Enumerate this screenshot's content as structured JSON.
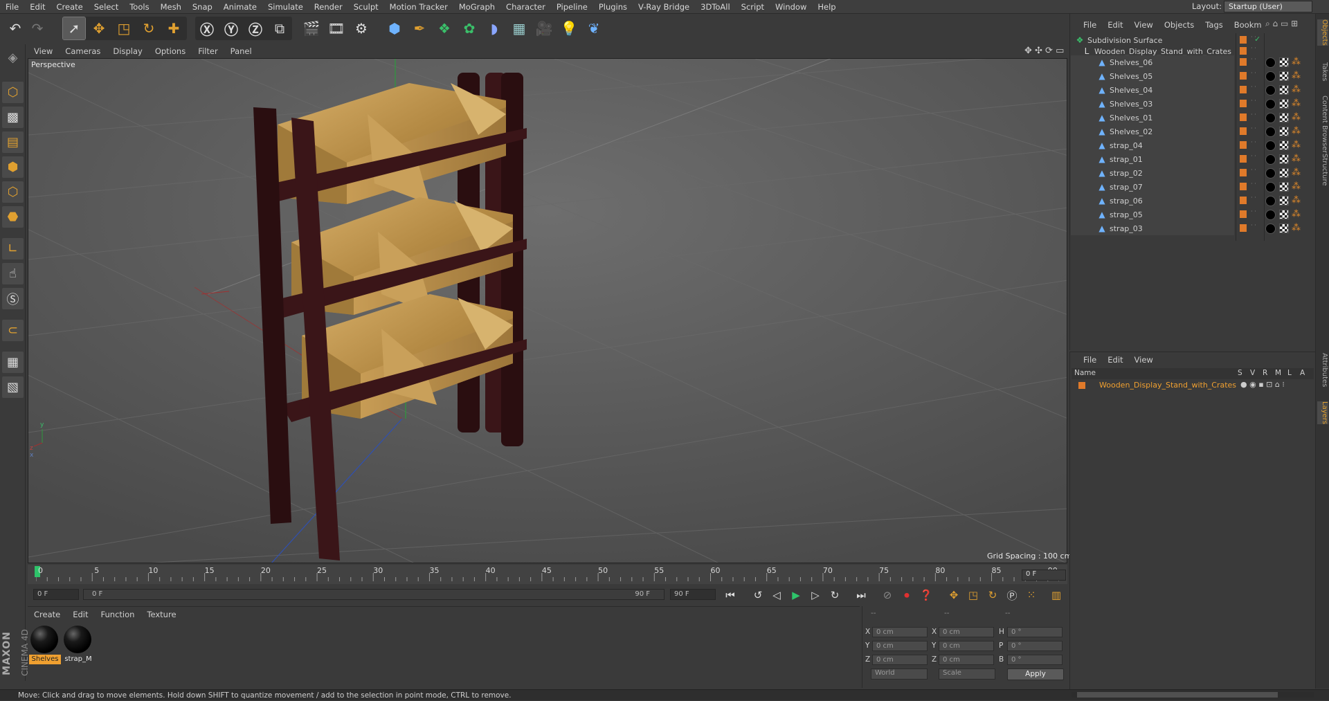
{
  "menubar": {
    "items": [
      "File",
      "Edit",
      "Create",
      "Select",
      "Tools",
      "Mesh",
      "Snap",
      "Animate",
      "Simulate",
      "Render",
      "Sculpt",
      "Motion Tracker",
      "MoGraph",
      "Character",
      "Pipeline",
      "Plugins",
      "V-Ray Bridge",
      "3DToAll",
      "Script",
      "Window",
      "Help"
    ],
    "layout_label": "Layout:",
    "layout_value": "Startup (User)"
  },
  "viewport": {
    "menu": [
      "View",
      "Cameras",
      "Display",
      "Options",
      "Filter",
      "Panel"
    ],
    "label": "Perspective",
    "grid_spacing": "Grid Spacing : 100 cm"
  },
  "timeline": {
    "ticks": [
      "0",
      "5",
      "10",
      "15",
      "20",
      "25",
      "30",
      "35",
      "40",
      "45",
      "50",
      "55",
      "60",
      "65",
      "70",
      "75",
      "80",
      "85",
      "90"
    ],
    "current_frame": "0 F",
    "start_field": "0 F",
    "range_start": "0 F",
    "range_end": "90 F",
    "end_field": "90 F"
  },
  "materials": {
    "menu": [
      "Create",
      "Edit",
      "Function",
      "Texture"
    ],
    "items": [
      {
        "label": "Shelves",
        "selected": true
      },
      {
        "label": "strap_M",
        "selected": false
      }
    ]
  },
  "coords": {
    "header_a": "--",
    "header_b": "--",
    "header_c": "--",
    "rows": [
      {
        "l1": "X",
        "v1": "0 cm",
        "l2": "X",
        "v2": "0 cm",
        "l3": "H",
        "v3": "0 °"
      },
      {
        "l1": "Y",
        "v1": "0 cm",
        "l2": "Y",
        "v2": "0 cm",
        "l3": "P",
        "v3": "0 °"
      },
      {
        "l1": "Z",
        "v1": "0 cm",
        "l2": "Z",
        "v2": "0 cm",
        "l3": "B",
        "v3": "0 °"
      }
    ],
    "world": "World",
    "scale": "Scale",
    "apply": "Apply"
  },
  "status": "Move: Click and drag to move elements. Hold down SHIFT to quantize movement / add to the selection in point mode, CTRL to remove.",
  "brand": {
    "maxon": "MAXON",
    "c4d": "CINEMA 4D"
  },
  "objects": {
    "menu": [
      "File",
      "Edit",
      "View",
      "Objects",
      "Tags",
      "Bookm"
    ],
    "root": "Subdivision Surface",
    "group": "Wooden_Display_Stand_with_Crates",
    "children": [
      "Shelves_06",
      "Shelves_05",
      "Shelves_04",
      "Shelves_03",
      "Shelves_01",
      "Shelves_02",
      "strap_04",
      "strap_01",
      "strap_02",
      "strap_07",
      "strap_06",
      "strap_05",
      "strap_03"
    ]
  },
  "layers": {
    "menu": [
      "File",
      "Edit",
      "View"
    ],
    "columns": [
      "Name",
      "S",
      "V",
      "R",
      "M",
      "L",
      "A"
    ],
    "row": "Wooden_Display_Stand_with_Crates"
  },
  "side_tabs": [
    "Objects",
    "Takes",
    "Content Browser",
    "Structure",
    "Attributes",
    "Layers"
  ],
  "colors": {
    "accent": "#e0a030",
    "selection": "#f0a030",
    "layer": "#e07a2a"
  }
}
